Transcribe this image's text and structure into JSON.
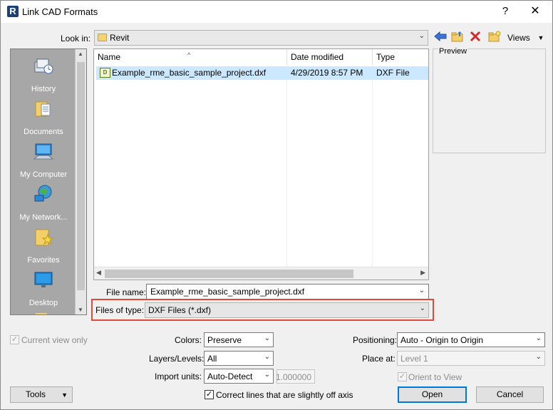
{
  "window": {
    "title": "Link CAD Formats",
    "app_icon": "R",
    "help_glyph": "?",
    "close_glyph": "✕"
  },
  "lookin": {
    "label": "Look in:",
    "value": "Revit"
  },
  "toolbar": {
    "views_label": "Views"
  },
  "places": [
    {
      "label": "History",
      "icon": "history-icon"
    },
    {
      "label": "Documents",
      "icon": "documents-icon"
    },
    {
      "label": "My Computer",
      "icon": "my-computer-icon"
    },
    {
      "label": "My Network...",
      "icon": "network-icon"
    },
    {
      "label": "Favorites",
      "icon": "favorites-icon"
    },
    {
      "label": "Desktop",
      "icon": "desktop-icon"
    }
  ],
  "filelist": {
    "columns": [
      "Name",
      "Date modified",
      "Type"
    ],
    "files": [
      {
        "name": "Example_rme_basic_sample_project.dxf",
        "date": "4/29/2019 8:57 PM",
        "type": "DXF File"
      }
    ]
  },
  "preview": {
    "label": "Preview"
  },
  "filename": {
    "label": "File name:",
    "value": "Example_rme_basic_sample_project.dxf"
  },
  "filetype": {
    "label": "Files of type:",
    "value": "DXF Files  (*.dxf)"
  },
  "options": {
    "current_view_only": {
      "label": "Current view only",
      "checked": true,
      "enabled": false
    },
    "colors": {
      "label": "Colors:",
      "value": "Preserve"
    },
    "layers": {
      "label": "Layers/Levels:",
      "value": "All"
    },
    "import_units": {
      "label": "Import units:",
      "value": "Auto-Detect",
      "scale": "1.000000"
    },
    "correct_lines": {
      "label": "Correct lines that are slightly off axis",
      "checked": true
    },
    "positioning": {
      "label": "Positioning:",
      "value": "Auto - Origin to Origin"
    },
    "place_at": {
      "label": "Place at:",
      "value": "Level 1"
    },
    "orient_to_view": {
      "label": "Orient to View",
      "checked": true,
      "enabled": false
    }
  },
  "buttons": {
    "tools": "Tools",
    "open": "Open",
    "cancel": "Cancel"
  }
}
